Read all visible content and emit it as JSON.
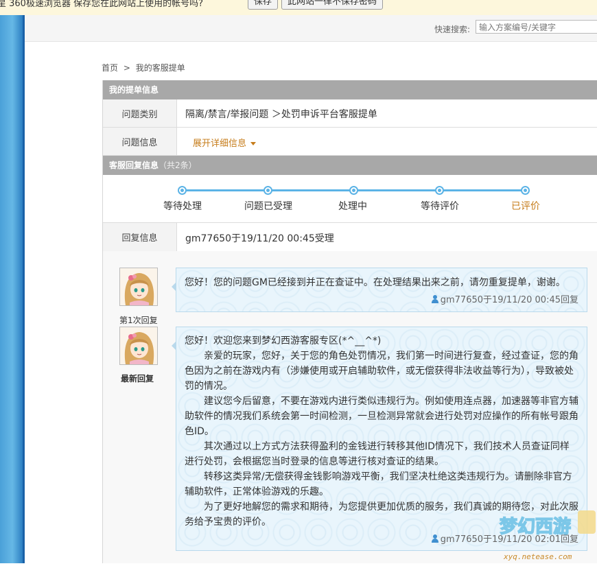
{
  "browser_notice": {
    "text": "星 360极速浏览器 保存您在此网站上使用的帐号吗?",
    "save_label": "保存",
    "never_label": "此网站一律不保存密码"
  },
  "quick_search": {
    "label": "快速搜索:",
    "placeholder": "输入方案编号/关键字"
  },
  "breadcrumb": {
    "home": "首页",
    "separator": ">",
    "current": "我的客服提单"
  },
  "ticket_info": {
    "section_title": "我的提单信息",
    "category_label": "问题类别",
    "category_value": "隔离/禁言/举报问题 ＞处罚申诉平台客服提单",
    "info_label": "问题信息",
    "expand_label": "展开详细信息"
  },
  "reply_info": {
    "section_title": "客服回复信息",
    "count_text": "（共2条）",
    "steps": [
      "等待处理",
      "问题已受理",
      "处理中",
      "等待评价",
      "已评价"
    ],
    "active_step": 4,
    "reply_label": "回复信息",
    "reply_value": "gm77650于19/11/20 00:45受理"
  },
  "replies": [
    {
      "avatar_label": "第1次回复",
      "paragraphs": [
        "您好！您的问题GM已经接到并正在查证中。在处理结果出来之前，请勿重复提单，谢谢。"
      ],
      "signature": "gm77650于19/11/20 00:45回复"
    },
    {
      "avatar_label": "最新回复",
      "greeting": "您好！欢迎您来到梦幻西游客服专区(*^__^*)",
      "paragraphs": [
        "亲爱的玩家，您好，关于您的角色处罚情况，我们第一时间进行复查，经过查证，您的角色因为之前在游戏内有（涉嫌使用或开启辅助软件，或无偿获得非法收益等行为），导致被处罚的情况。",
        "建议您今后留意，不要在游戏内进行类似违规行为。例如使用连点器，加速器等非官方辅助软件的情况我们系统会第一时间检测，一旦检测异常就会进行处罚对应操作的所有帐号跟角色ID。",
        "其次通过以上方式方法获得盈利的金钱进行转移其他ID情况下，我们技术人员查证同样进行处罚，会根据您当时登录的信息等进行核对查证的结果。",
        "转移这类异常/无偿获得金钱影响游戏平衡，我们坚决杜绝这类违规行为。请删除非官方辅助软件，正常体验游戏的乐趣。",
        "为了更好地解您的需求和期待，为您提供更加优质的服务，我们真诚的期待您，对此次服务给予宝贵的评价。"
      ],
      "signature": "gm77650于19/11/20 02:01回复"
    }
  ],
  "watermark": {
    "logo_text": "梦幻西游",
    "url": "xyq.netease.com"
  },
  "colors": {
    "accent_blue": "#5bb3e6",
    "accent_orange": "#c67c1a",
    "section_gray": "#a8a8a8"
  }
}
